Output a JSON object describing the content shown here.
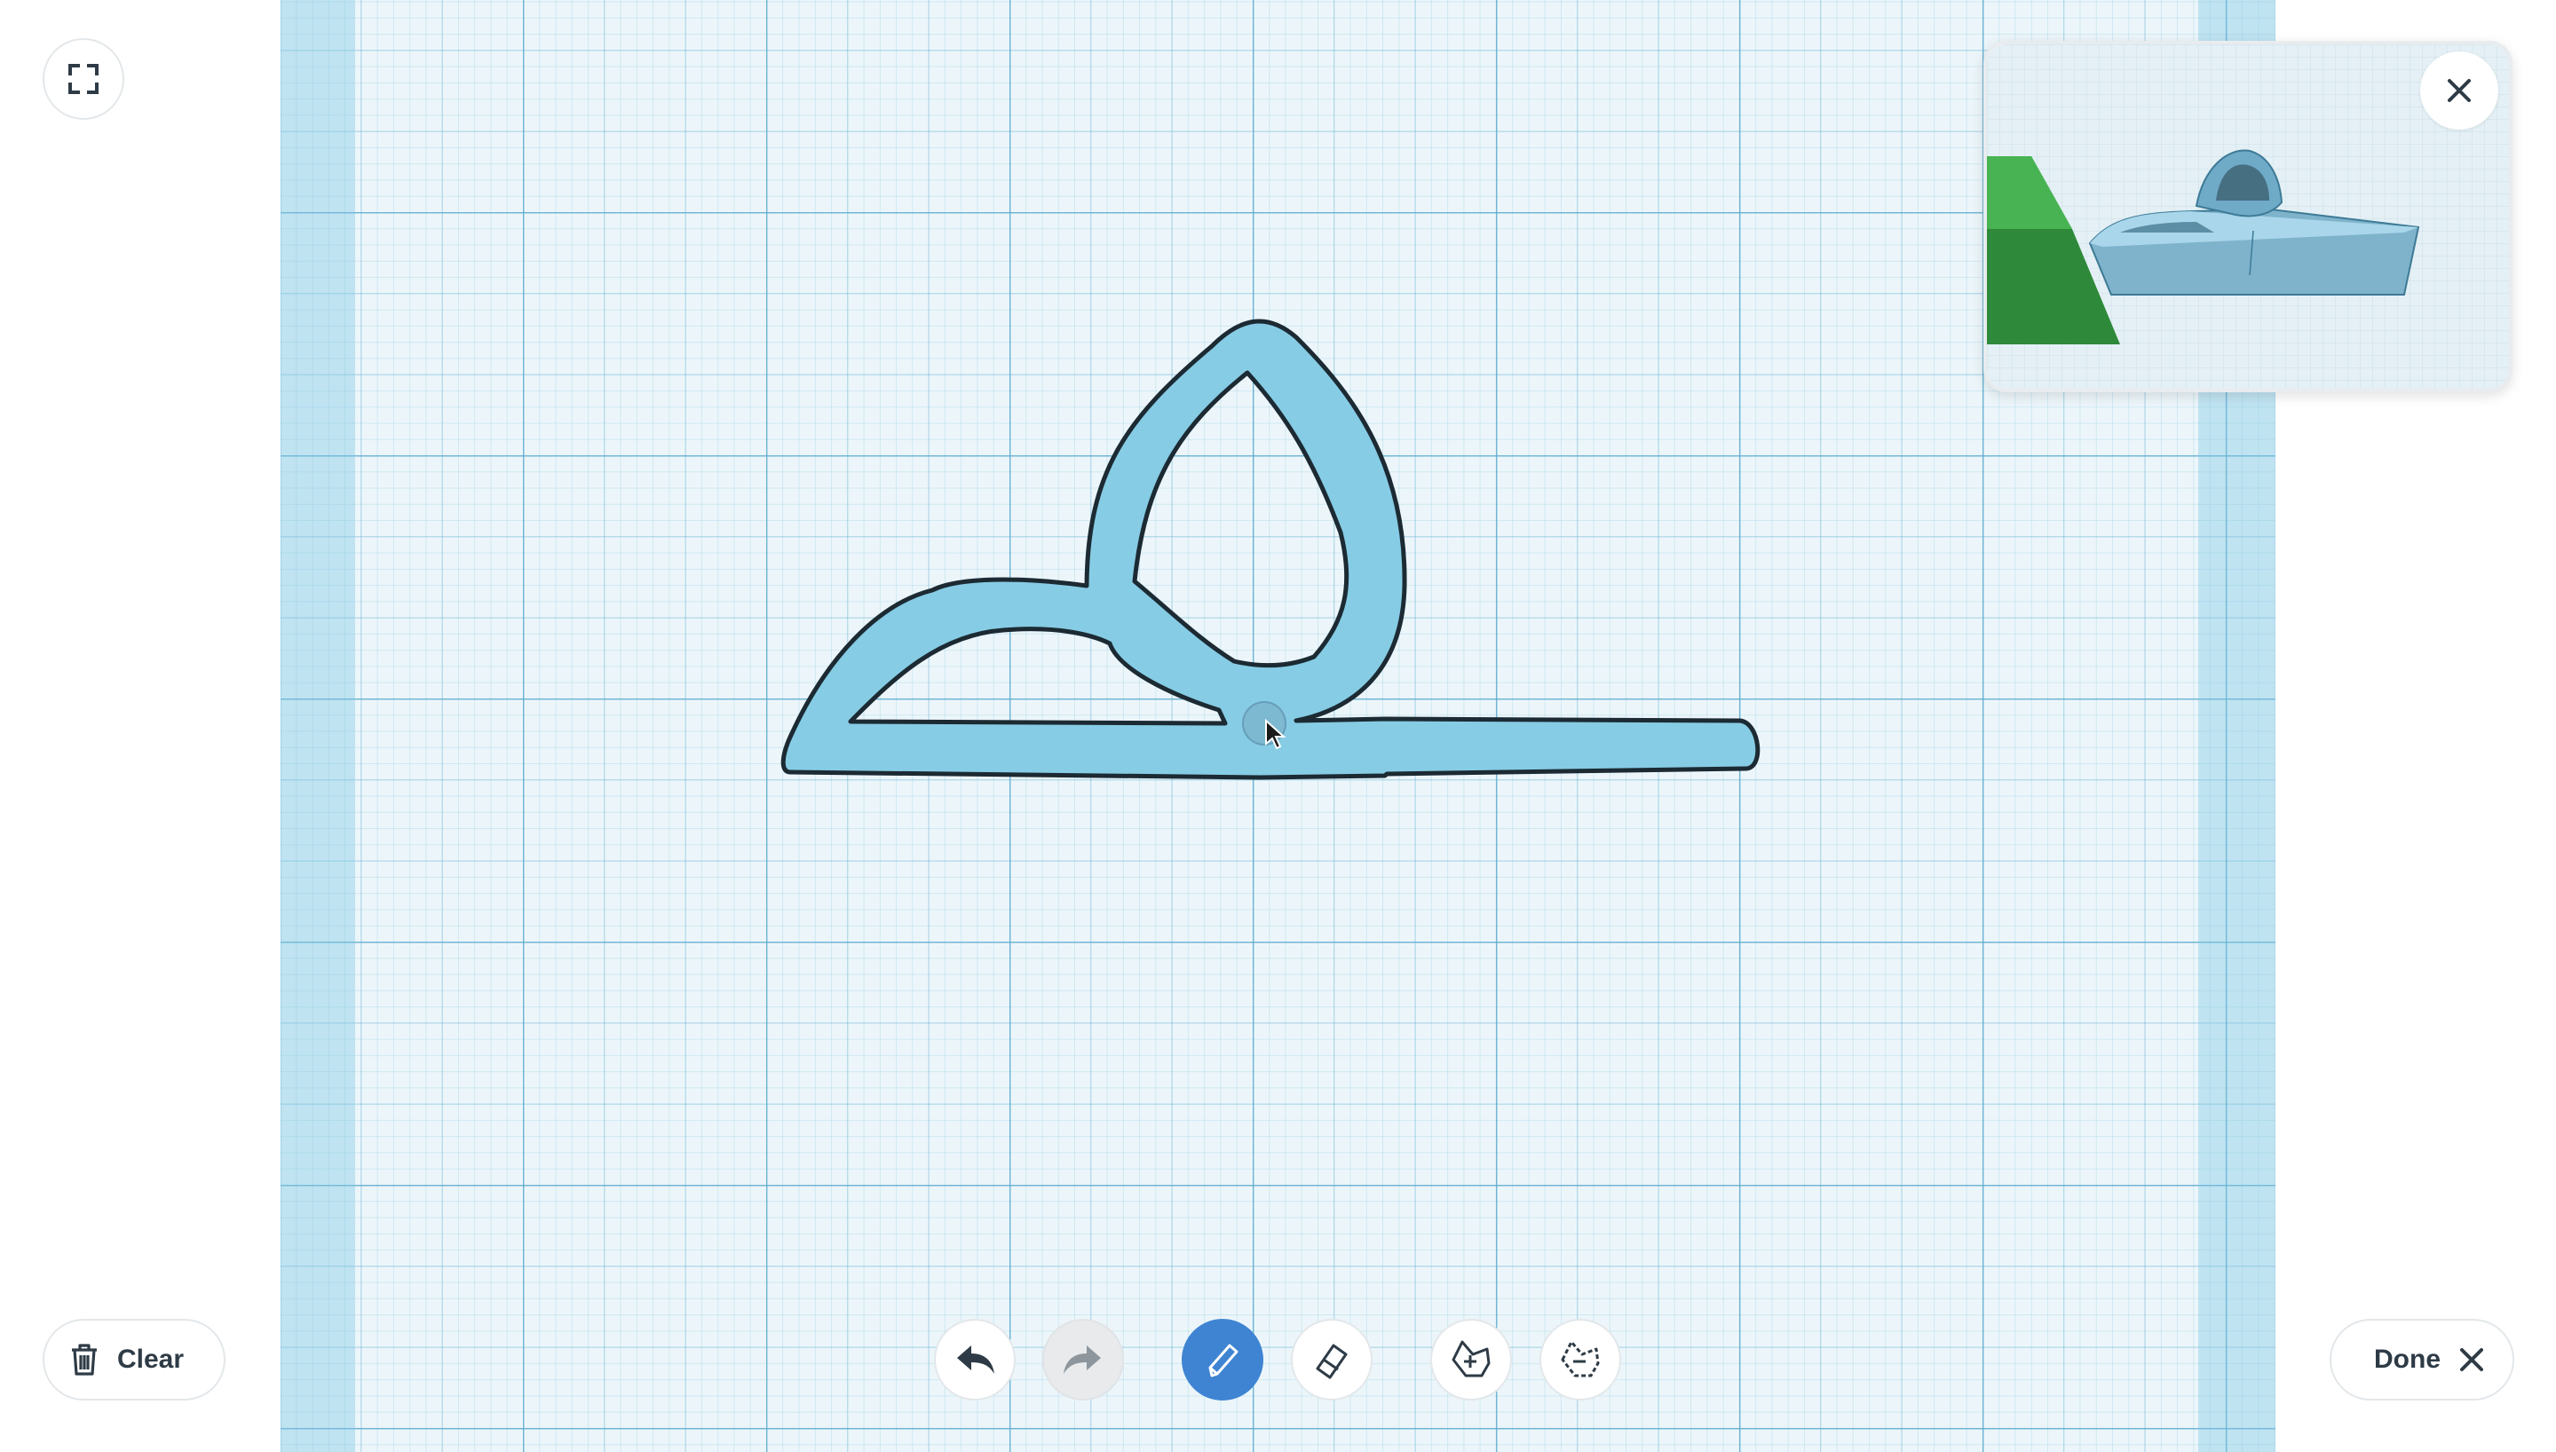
{
  "toolbar": {
    "clear_label": "Clear",
    "done_label": "Done"
  },
  "buttons": {
    "fullscreen_icon": "fullscreen-icon",
    "undo_icon": "undo-icon",
    "redo_icon": "redo-icon",
    "pencil_icon": "pencil-icon",
    "eraser_icon": "eraser-icon",
    "shape_add_icon": "shape-add-icon",
    "shape_remove_icon": "shape-remove-icon",
    "close_icon": "close-icon"
  },
  "state": {
    "active_tool": "pencil",
    "redo_enabled": false
  },
  "colors": {
    "shape_fill": "#86cce4",
    "shape_outline": "#1c2a33",
    "accent": "#3f84d2",
    "grid_background": "#ecf6fa",
    "preview_green": "#3ea34a"
  }
}
